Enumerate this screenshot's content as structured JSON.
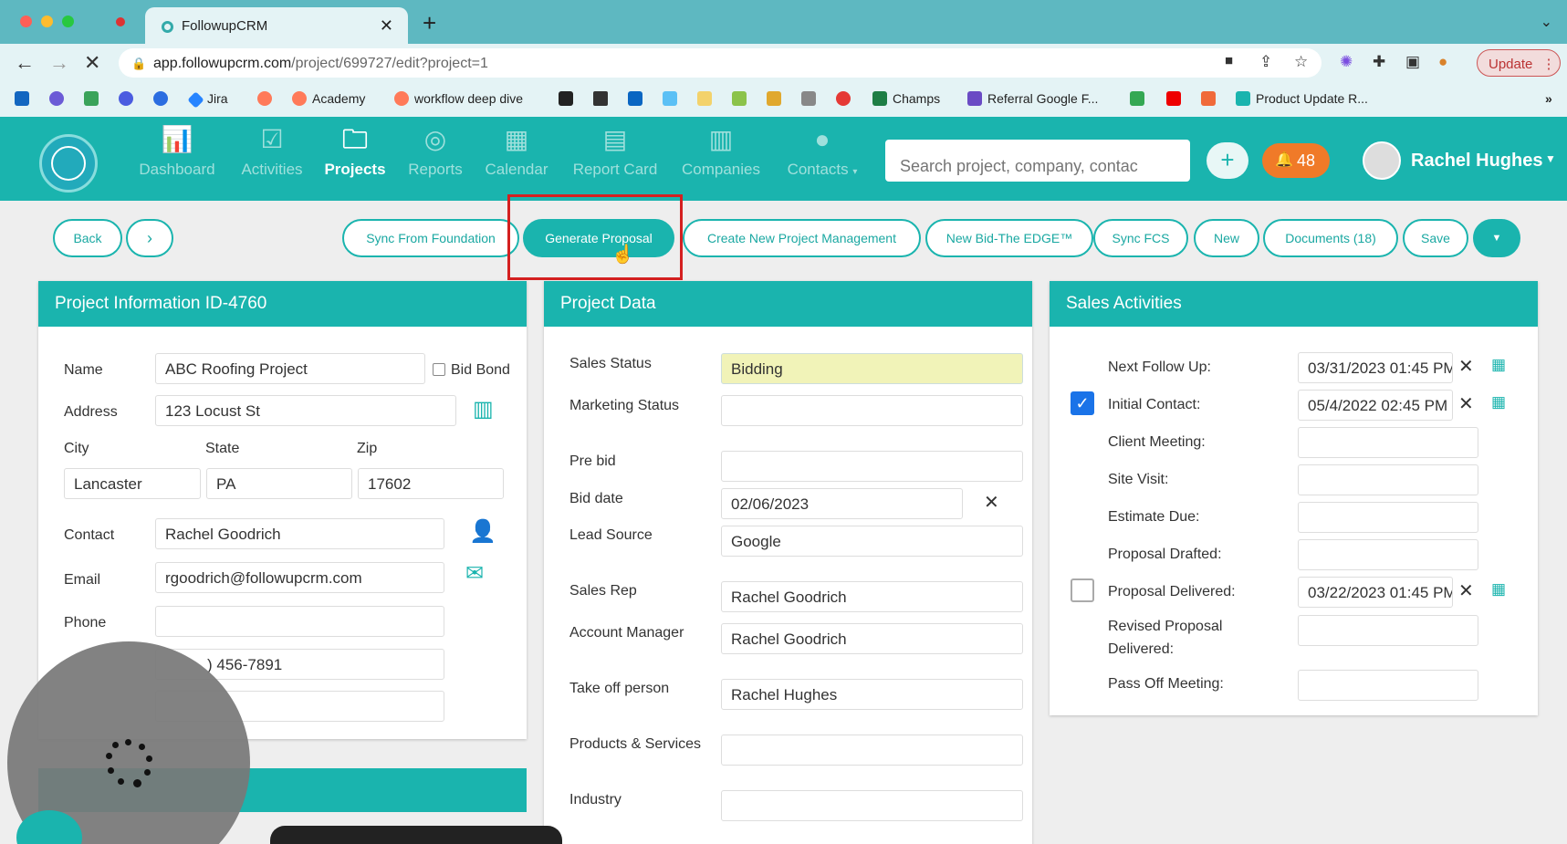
{
  "browser": {
    "tab_title": "FollowupCRM",
    "url_domain": "app.followupcrm.com",
    "url_path": "/project/699727/edit?project=1",
    "update_label": "Update",
    "bookmarks": [
      "Jira",
      "Academy",
      "workflow deep dive",
      "Champs",
      "Referral Google F...",
      "Product Update R..."
    ],
    "more": "»"
  },
  "nav": {
    "items": [
      {
        "label": "Dashboard",
        "icon": "bar-chart-icon"
      },
      {
        "label": "Activities",
        "icon": "checklist-icon"
      },
      {
        "label": "Projects",
        "icon": "folder-icon"
      },
      {
        "label": "Reports",
        "icon": "target-icon"
      },
      {
        "label": "Calendar",
        "icon": "calendar-icon"
      },
      {
        "label": "Report Card",
        "icon": "report-card-icon"
      },
      {
        "label": "Companies",
        "icon": "building-icon"
      },
      {
        "label": "Contacts",
        "icon": "person-icon"
      }
    ],
    "search_placeholder": "Search project, company, contac",
    "notifications": "48",
    "user_name": "Rachel Hughes"
  },
  "toolbar": {
    "back": "Back",
    "sync_foundation": "Sync From Foundation",
    "generate_proposal": "Generate Proposal",
    "create_pm": "Create New Project Management",
    "new_bid": "New Bid-The EDGE™",
    "sync_fcs": "Sync FCS",
    "new": "New",
    "documents": "Documents (18)",
    "save": "Save"
  },
  "project_info": {
    "title": "Project Information ID-4760",
    "name_label": "Name",
    "name": "ABC Roofing Project",
    "bid_bond_label": "Bid Bond",
    "address_label": "Address",
    "address": "123 Locust St",
    "city_label": "City",
    "city": "Lancaster",
    "state_label": "State",
    "state": "PA",
    "zip_label": "Zip",
    "zip": "17602",
    "contact_label": "Contact",
    "contact": "Rachel Goodrich",
    "email_label": "Email",
    "email": "rgoodrich@followupcrm.com",
    "phone_label": "Phone",
    "phone": "",
    "phone2": ") 456-7891"
  },
  "project_data": {
    "title": "Project Data",
    "sales_status_label": "Sales Status",
    "sales_status": "Bidding",
    "marketing_status_label": "Marketing Status",
    "marketing_status": "",
    "pre_bid_label": "Pre bid",
    "pre_bid": "",
    "bid_date_label": "Bid date",
    "bid_date": "02/06/2023",
    "lead_source_label": "Lead Source",
    "lead_source": "Google",
    "sales_rep_label": "Sales Rep",
    "sales_rep": "Rachel Goodrich",
    "account_manager_label": "Account Manager",
    "account_manager": "Rachel Goodrich",
    "takeoff_label": "Take off person",
    "takeoff": "Rachel Hughes",
    "products_label": "Products & Services",
    "products": "",
    "industry_label": "Industry",
    "industry": ""
  },
  "sales_activities": {
    "title": "Sales Activities",
    "next_follow_up_label": "Next Follow Up:",
    "next_follow_up": "03/31/2023 01:45 PM",
    "initial_contact_label": "Initial Contact:",
    "initial_contact": "05/4/2022 02:45 PM",
    "client_meeting_label": "Client Meeting:",
    "site_visit_label": "Site Visit:",
    "estimate_due_label": "Estimate Due:",
    "proposal_drafted_label": "Proposal Drafted:",
    "proposal_delivered_label": "Proposal Delivered:",
    "proposal_delivered": "03/22/2023 01:45 PM",
    "revised_label_1": "Revised Proposal",
    "revised_label_2": "Delivered:",
    "pass_off_label": "Pass Off Meeting:"
  },
  "colors": {
    "accent": "#1ab4ae",
    "highlight": "#d42020",
    "notification": "#f07a28"
  }
}
